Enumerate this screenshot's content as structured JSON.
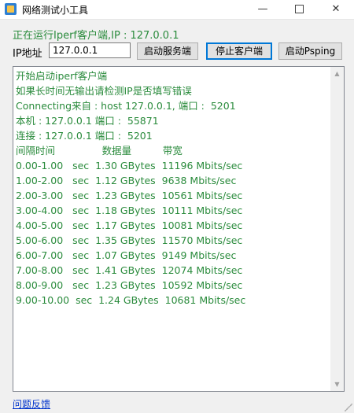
{
  "window": {
    "title": "网络测试小工具",
    "min_glyph": "—",
    "close_glyph": "✕"
  },
  "status": "正在运行Iperf客户端,IP : 127.0.0.1",
  "ip_field": {
    "label": "IP地址",
    "value": "127.0.0.1"
  },
  "buttons": {
    "start_server": "启动服务端",
    "stop_client": "停止客户端",
    "start_psping": "启动Psping"
  },
  "log": [
    "开始启动iperf客户端",
    "如果长时间无输出请检测IP是否填写错误",
    "Connecting来自 : host 127.0.0.1, 端口 :  5201",
    "本机 : 127.0.0.1 端口 :  55871",
    "连接 : 127.0.0.1 端口 :  5201",
    "间隔时间               数据量          带宽",
    "0.00-1.00   sec  1.30 GBytes  11196 Mbits/sec",
    "1.00-2.00   sec  1.12 GBytes  9638 Mbits/sec",
    "2.00-3.00   sec  1.23 GBytes  10561 Mbits/sec",
    "3.00-4.00   sec  1.18 GBytes  10111 Mbits/sec",
    "4.00-5.00   sec  1.17 GBytes  10081 Mbits/sec",
    "5.00-6.00   sec  1.35 GBytes  11570 Mbits/sec",
    "6.00-7.00   sec  1.07 GBytes  9149 Mbits/sec",
    "7.00-8.00   sec  1.41 GBytes  12074 Mbits/sec",
    "8.00-9.00   sec  1.23 GBytes  10592 Mbits/sec",
    "9.00-10.00  sec  1.24 GBytes  10681 Mbits/sec"
  ],
  "scroll": {
    "up_glyph": "▲",
    "down_glyph": "▼"
  },
  "feedback_link": "问题反馈",
  "colors": {
    "log_text": "#2a8b3c",
    "link": "#0033cc",
    "focus_border": "#0078d7"
  },
  "icons": {
    "app": "app-icon",
    "minimize": "minimize-icon",
    "maximize": "maximize-icon",
    "close": "close-icon"
  }
}
